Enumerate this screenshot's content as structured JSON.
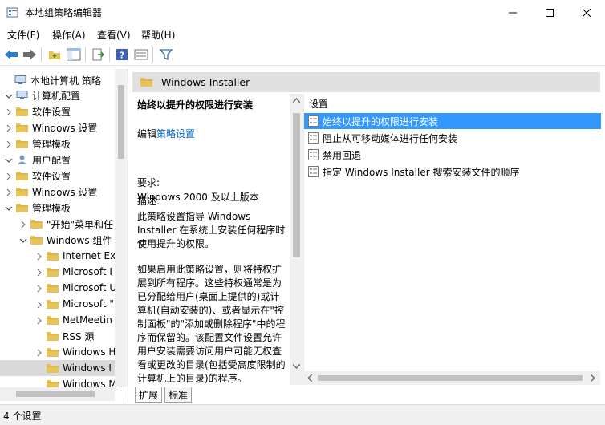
{
  "window": {
    "title": "本地组策略编辑器"
  },
  "menu": [
    "文件(F)",
    "操作(A)",
    "查看(V)",
    "帮助(H)"
  ],
  "tree": {
    "items": [
      {
        "label": "本地计算机 策略"
      },
      {
        "label": "计算机配置"
      },
      {
        "label": "软件设置"
      },
      {
        "label": "Windows 设置"
      },
      {
        "label": "管理模板"
      },
      {
        "label": "用户配置"
      },
      {
        "label": "软件设置"
      },
      {
        "label": "Windows 设置"
      },
      {
        "label": "管理模板"
      },
      {
        "label": "\"开始\"菜单和任"
      },
      {
        "label": "Windows 组件"
      },
      {
        "label": "Internet Ex"
      },
      {
        "label": "Microsoft I"
      },
      {
        "label": "Microsoft U"
      },
      {
        "label": "Microsoft \""
      },
      {
        "label": "NetMeetin"
      },
      {
        "label": "RSS 源"
      },
      {
        "label": "Windows H"
      },
      {
        "label": "Windows I"
      },
      {
        "label": "Windows M"
      }
    ]
  },
  "right_pane": {
    "title": "Windows Installer"
  },
  "description": {
    "policy_title": "始终以提升的权限进行安装",
    "edit_prefix": "编辑",
    "edit_link": "策略设置",
    "req_label": "要求:",
    "req_value": "Windows 2000 及以上版本",
    "desc_label": "描述:",
    "desc_text": "此策略设置指导 Windows Installer 在系统上安装任何程序时使用提升的权限。",
    "desc_more": "如果启用此策略设置，则将特权扩展到所有程序。这些特权通常是为已分配给用户(桌面上提供的)或计算机(自动安装的)、或者显示在\"控制面板\"的\"添加或删除程序\"中的程序而保留的。该配置文件设置允许用户安装需要访问用户可能无权查看或更改的目录(包括受高度限制的计算机上的目录)的程序。"
  },
  "list": {
    "column_header": "设置",
    "rows": [
      {
        "label": "始终以提升的权限进行安装"
      },
      {
        "label": "阻止从可移动媒体进行任何安装"
      },
      {
        "label": "禁用回退"
      },
      {
        "label": "指定 Windows Installer 搜索安装文件的顺序"
      }
    ]
  },
  "tabs": [
    "扩展",
    "标准"
  ],
  "status": {
    "text": "4 个设置"
  },
  "colors": {
    "selection": "#3399ff",
    "header_bg": "#e0e0e0",
    "folder": "#e8c35a",
    "link": "#0066cc"
  }
}
